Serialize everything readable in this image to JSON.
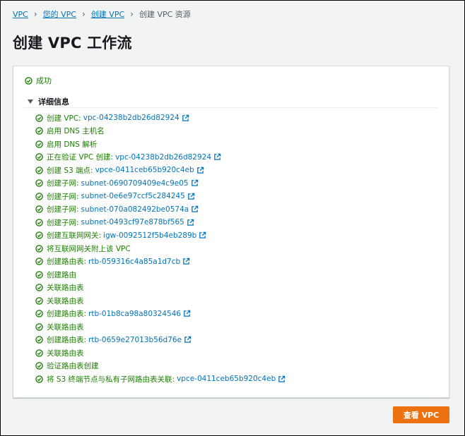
{
  "breadcrumb": [
    {
      "label": "VPC",
      "link": true
    },
    {
      "label": "您的 VPC",
      "link": true
    },
    {
      "label": "创建 VPC",
      "link": true
    },
    {
      "label": "创建 VPC 资源",
      "link": false
    }
  ],
  "page_title": "创建 VPC 工作流",
  "status": "成功",
  "details_label": "详细信息",
  "steps": [
    {
      "text": "创建 VPC:",
      "link": "vpc-04238b2db26d82924"
    },
    {
      "text": "启用 DNS 主机名",
      "link": null
    },
    {
      "text": "启用 DNS 解析",
      "link": null
    },
    {
      "text": "正在验证 VPC 创建:",
      "link": "vpc-04238b2db26d82924"
    },
    {
      "text": "创建 S3 端点:",
      "link": "vpce-0411ceb65b920c4eb"
    },
    {
      "text": "创建子网:",
      "link": "subnet-0690709409e4c9e05"
    },
    {
      "text": "创建子网:",
      "link": "subnet-0e6e97ccf5c284245"
    },
    {
      "text": "创建子网:",
      "link": "subnet-070a082492be0574a"
    },
    {
      "text": "创建子网:",
      "link": "subnet-0493cf97e878bf565"
    },
    {
      "text": "创建互联网网关:",
      "link": "igw-0092512f5b4eb289b"
    },
    {
      "text": "将互联网网关附上该 VPC",
      "link": null
    },
    {
      "text": "创建路由表:",
      "link": "rtb-059316c4a85a1d7cb"
    },
    {
      "text": "创建路由",
      "link": null
    },
    {
      "text": "关联路由表",
      "link": null
    },
    {
      "text": "关联路由表",
      "link": null
    },
    {
      "text": "创建路由表:",
      "link": "rtb-01b8ca98a80324546"
    },
    {
      "text": "关联路由表",
      "link": null
    },
    {
      "text": "创建路由表:",
      "link": "rtb-0659e27013b56d76e"
    },
    {
      "text": "关联路由表",
      "link": null
    },
    {
      "text": "验证路由表创建",
      "link": null
    },
    {
      "text": "将 S3 终端节点与私有子网路由表关联:",
      "link": "vpce-0411ceb65b920c4eb"
    }
  ],
  "view_button": "查看 VPC",
  "colors": {
    "success": "#1d8102",
    "link": "#0073bb",
    "primary_button": "#ec7211",
    "background": "#f2f3f3"
  }
}
